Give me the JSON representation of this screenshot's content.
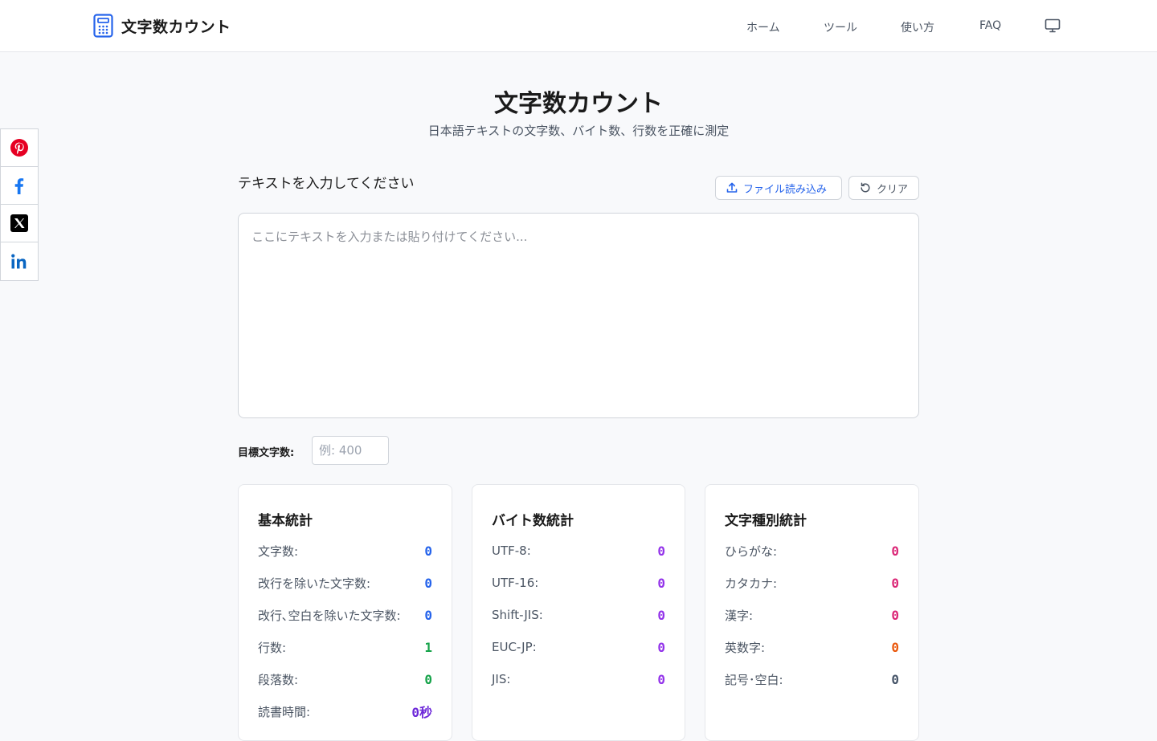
{
  "header": {
    "logo_text": "文字数カウント",
    "nav": [
      {
        "label": "ホーム"
      },
      {
        "label": "ツール"
      },
      {
        "label": "使い方"
      },
      {
        "label": "FAQ"
      }
    ]
  },
  "share": [
    "pinterest-icon",
    "facebook-icon",
    "x-icon",
    "linkedin-icon"
  ],
  "main": {
    "title": "文字数カウント",
    "subtitle": "日本語テキストの文字数、バイト数、行数を正確に測定",
    "input_label": "テキストを入力してください",
    "file_button": "ファイル読み込み",
    "clear_button": "クリア",
    "textarea_placeholder": "ここにテキストを入力または貼り付けてください...",
    "target_label": "目標文字数:",
    "target_placeholder": "例: 400"
  },
  "cards": {
    "basic": {
      "title": "基本統計",
      "rows": [
        {
          "label": "文字数:",
          "value": "0",
          "color": "#2563eb"
        },
        {
          "label": "改行を除いた文字数:",
          "value": "0",
          "color": "#2563eb"
        },
        {
          "label": "改行､空白を除いた文字数:",
          "value": "0",
          "color": "#2563eb"
        },
        {
          "label": "行数:",
          "value": "1",
          "color": "#16a34a"
        },
        {
          "label": "段落数:",
          "value": "0",
          "color": "#16a34a"
        },
        {
          "label": "読書時間:",
          "value": "0秒",
          "color": "#6d28d9"
        }
      ]
    },
    "bytes": {
      "title": "バイト数統計",
      "rows": [
        {
          "label": "UTF-8:",
          "value": "0",
          "color": "#9333ea"
        },
        {
          "label": "UTF-16:",
          "value": "0",
          "color": "#9333ea"
        },
        {
          "label": "Shift-JIS:",
          "value": "0",
          "color": "#9333ea"
        },
        {
          "label": "EUC-JP:",
          "value": "0",
          "color": "#9333ea"
        },
        {
          "label": "JIS:",
          "value": "0",
          "color": "#9333ea"
        }
      ]
    },
    "types": {
      "title": "文字種別統計",
      "rows": [
        {
          "label": "ひらがな:",
          "value": "0",
          "color": "#db2777"
        },
        {
          "label": "カタカナ:",
          "value": "0",
          "color": "#db2777"
        },
        {
          "label": "漢字:",
          "value": "0",
          "color": "#db2777"
        },
        {
          "label": "英数字:",
          "value": "0",
          "color": "#ea580c"
        },
        {
          "label": "記号･空白:",
          "value": "0",
          "color": "#475569"
        }
      ]
    }
  }
}
